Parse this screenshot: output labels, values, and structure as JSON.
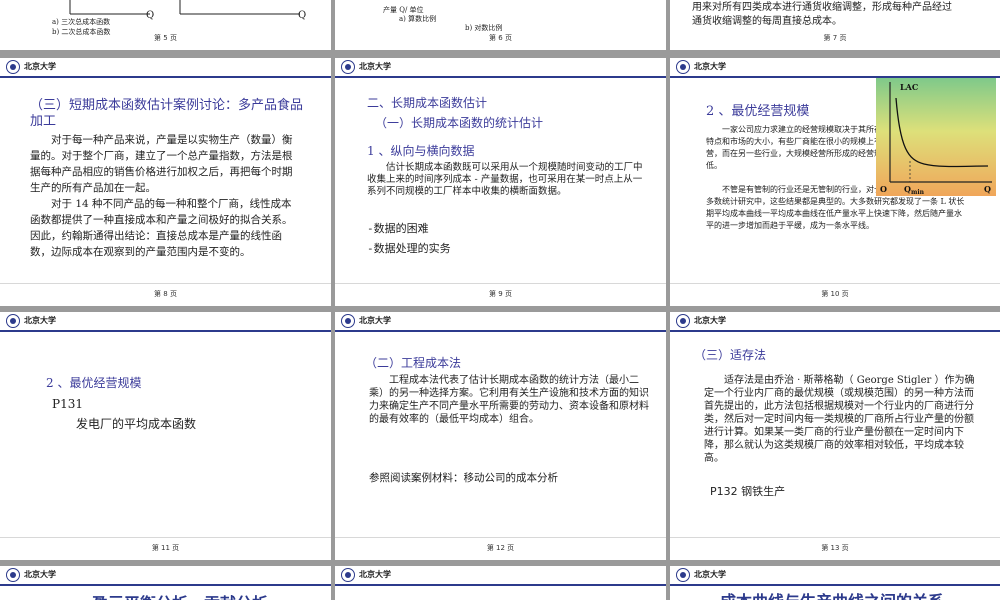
{
  "university": "北京大学",
  "top_row": {
    "s5": {
      "caption_a": "a)  三次总成本函数",
      "caption_b": "b)  二次总成本函数",
      "axis_q": "Q",
      "axis_q2": "Q",
      "page": "第 5 页"
    },
    "s6": {
      "label_unit": "产量 Q/ 单位",
      "caption_a": "a)  算数比例",
      "caption_b": "b)  对数比例",
      "page": "第 6 页"
    },
    "s7": {
      "line1": "用来对所有四类成本进行通货收缩调整，形成每种产品经过",
      "line2": "通货收缩调整的每周直接总成本。",
      "page": "第 7 页"
    }
  },
  "s8": {
    "title_line1": "（三）短期成本函数估计案例讨论：多产品食品",
    "title_line2": "加工",
    "para1": "对于每一种产品来说，产量是以实物生产（数量）衡量的。对于整个厂商，建立了一个总产量指数，方法是根据每种产品相应的销售价格进行加权之后，再把每个时期生产的所有产品加在一起。",
    "para2": "对于 14 种不同产品的每一种和整个厂商，线性成本函数都提供了一种直接成本和产量之间极好的拟合关系。因此，约翰斯通得出结论：直接总成本是产量的线性函数，边际成本在观察到的产量范围内是不变的。",
    "page": "第 8 页"
  },
  "s9": {
    "title1": "二、长期成本函数估计",
    "title2": "（一）长期成本函数的统计估计",
    "title3": "1 、纵向与横向数据",
    "para": "估计长期成本函数既可以采用从一个规模随时间变动的工厂中收集上来的时间序列成本 - 产量数据，也可采用在某一时点上从一系列不同规模的工厂样本中收集的横断面数据。",
    "item1": "-数据的困难",
    "item2": "-数据处理的实务",
    "page": "第 9 页"
  },
  "s10": {
    "title": "2 、最优经营规模",
    "para1": "一家公司应力求建立的经营规模取决于其所在行业的特点和市场的大小，有些厂商能在很小的规模上有效地经营，而在另一些行业，大规模经营所形成的经营规模经营低。",
    "para2": "不管是有管制的行业还是无管制的行业，对长期成本 - 产量性态的大多数统计研究中，这些结果都是典型的。大多数研究都发现了一条 L 状长期平均成本曲线一平均成本曲线在低产量水平上快速下降，然后随产量水平的进一步增加而趋于平缓，成为一条水平线。",
    "chart_lac": "LAC",
    "chart_o": "O",
    "chart_qmin": "Q",
    "chart_qmin_sub": "min",
    "chart_q": "Q",
    "page": "第 10 页"
  },
  "s11": {
    "title": "2 、最优经营规模",
    "ref": "P131",
    "text": "发电厂的平均成本函数",
    "page": "第 11 页"
  },
  "s12": {
    "title": "（二）工程成本法",
    "para": "工程成本法代表了估计长期成本函数的统计方法（最小二乘）的另一种选择方案。它利用有关生产设施和技术方面的知识力来确定生产不同产量水平所需要的劳动力、资本设备和原材料的最有效率的（最低平均成本）组合。",
    "reading": "参照阅读案例材料：移动公司的成本分析",
    "page": "第 12 页"
  },
  "s13": {
    "title": "（三）适存法",
    "para": "适存法是由乔治 · 斯蒂格勒（ George Stigler ）作为确定一个行业内厂商的最优规模（或规模范围）的另一种方法而首先提出的，此方法包括根据规模对一个行业内的厂商进行分类，然后对一定时间内每一类规模的厂商所占行业产量的份额进行计算。如果某一类厂商的行业产量份额在一定时间内下降，那么就认为这类规模厂商的效率相对较低，平均成本较高。",
    "ref": "P132 钢铁生产",
    "page": "第 13 页"
  },
  "bottom_row": {
    "s14_title": "盈亏平衡分析、贡献分析",
    "s16_title": "成本曲线与生产曲线之间的关系"
  },
  "colors": {
    "accent": "#3b3b9a",
    "header_rule": "#2c3a8c",
    "background": "#9a9a9a"
  }
}
